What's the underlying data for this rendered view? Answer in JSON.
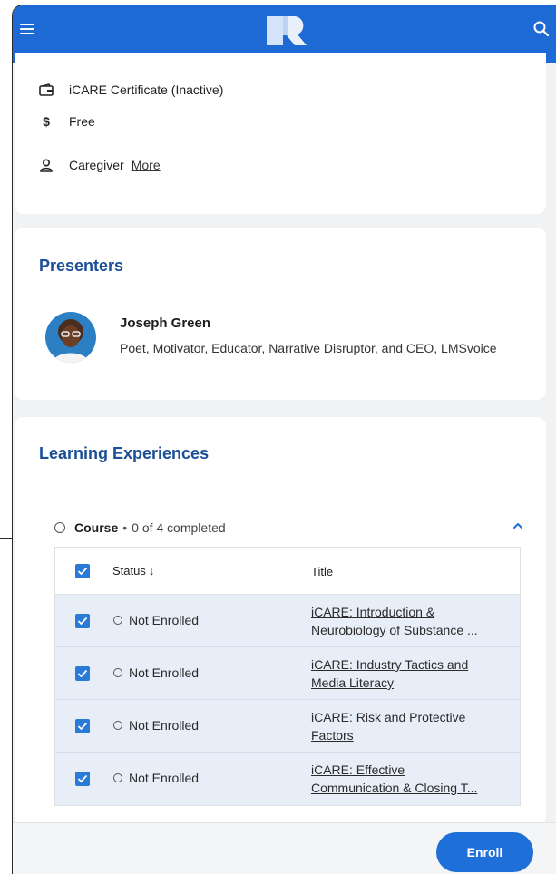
{
  "header": {
    "menu_icon": "hamburger-menu-icon",
    "logo": "brand-logo",
    "search_icon": "search-icon",
    "accent_color": "#1d6ad4"
  },
  "info": {
    "certificate": "iCARE Certificate (Inactive)",
    "price_symbol": "$",
    "price": "Free",
    "audience": "Caregiver",
    "more_link": "More"
  },
  "presenters": {
    "title": "Presenters",
    "items": [
      {
        "name": "Joseph Green",
        "role": "Poet, Motivator, Educator, Narrative Disruptor, and CEO, LMSvoice"
      }
    ]
  },
  "learning": {
    "title": "Learning Experiences",
    "course_label": "Course",
    "course_separator": "•",
    "course_progress": "0 of 4 completed",
    "table": {
      "headers": {
        "status": "Status",
        "status_sort_icon": "↓",
        "title": "Title"
      },
      "rows": [
        {
          "status": "Not Enrolled",
          "title_line1": "iCARE: Introduction &",
          "title_line2": "Neurobiology of Substance ..."
        },
        {
          "status": "Not Enrolled",
          "title_line1": "iCARE: Industry Tactics and",
          "title_line2": "Media Literacy"
        },
        {
          "status": "Not Enrolled",
          "title_line1": "iCARE: Risk and Protective",
          "title_line2": "Factors"
        },
        {
          "status": "Not Enrolled",
          "title_line1": "iCARE: Effective",
          "title_line2": "Communication & Closing T..."
        }
      ]
    }
  },
  "footer": {
    "enroll_label": "Enroll",
    "button_color": "#1f6fd8"
  }
}
